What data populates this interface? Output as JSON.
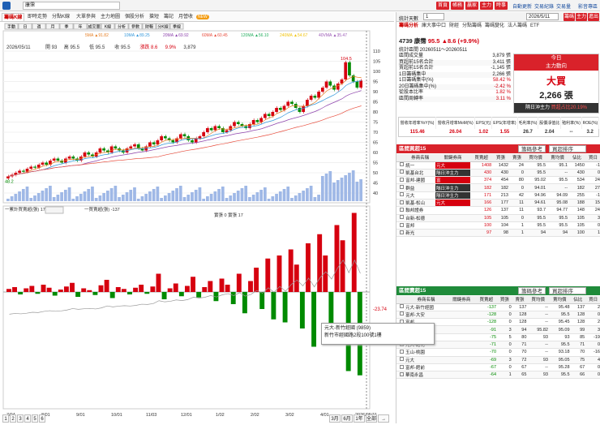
{
  "app": {
    "title": "康霈",
    "search": ""
  },
  "top_buttons": [
    "首頁",
    "帳務",
    "贏家",
    "主力",
    "時事"
  ],
  "top_links": [
    "自動更新",
    "交易紀錄",
    "交易量",
    "影音專區"
  ],
  "chart_tabs": [
    "籌碼K線",
    "即時走勢",
    "分點K線",
    "大單參與",
    "主力地圖",
    "個股分析",
    "搶短",
    "籌記",
    "月營收",
    "NEW"
  ],
  "chart_sub": [
    "手動",
    "日",
    "週",
    "月",
    "季",
    "年",
    "成交量",
    "K線",
    "分析",
    "參數",
    "財報",
    "分K線",
    "季線"
  ],
  "ma_legend": [
    "5MA ▲91.82",
    "10MA ▲89.25",
    "20MA ▲69.92",
    "60MA ▲60.45",
    "120MA ▲56.10",
    "240MA ▲54.67",
    "40VMA ▲35.47"
  ],
  "ohlc": {
    "date": "2026/05/11",
    "o": "開 93",
    "h": "高 95.5",
    "l": "低 95.5",
    "c": "收 95.5",
    "chg": "漲跌 8.6",
    "pct": "9.9%",
    "vol": "3,879"
  },
  "sub_legend": [
    "一累計買賣超(張) 17",
    "一買賣超(張) -137",
    "實張 0 實張 17"
  ],
  "peak_label": "104.5",
  "low_label": "48.2",
  "price_axis": [
    "110",
    "105",
    "100",
    "95",
    "90",
    "85",
    "80",
    "75",
    "70",
    "65",
    "60",
    "55",
    "50",
    "45",
    "40"
  ],
  "sub_axis": {
    "top": "",
    "mid": "",
    "last": "-23.74"
  },
  "date_axis": [
    "7/04",
    "8/01",
    "9/01",
    "10/01",
    "11/03",
    "12/01",
    "1/02",
    "2/02",
    "3/02",
    "4/01",
    "2026/05/11"
  ],
  "bottom_left": [
    "1",
    "2",
    "3",
    "4",
    "5",
    "6"
  ],
  "bottom_right": [
    "3月",
    "6月",
    "1年",
    "全部",
    "→"
  ],
  "right": {
    "days_label": "統計天數",
    "days_value": "1",
    "date_label": "2026/5/11",
    "btns": [
      "籌碼",
      "主力",
      "進出"
    ],
    "tabs": [
      "籌碼分析",
      "庫大事中口",
      "財經",
      "分點籌碼",
      "籌碼變化",
      "法人籌碼",
      "ETF"
    ],
    "stock": "4739 康霈",
    "price": "95.5",
    "change": "▲8.6 (+9.9%)",
    "info": [
      [
        "區間成交量",
        "3,879 張"
      ],
      [
        "買超前15名合計",
        "3,411 張"
      ],
      [
        "賣超前15名合計",
        "-1,145 張"
      ],
      [
        "1日籌碼集中",
        "2,266 張"
      ],
      [
        "1日籌碼集中(%)",
        "58.42 %"
      ],
      [
        "20日籌碼集中(%)",
        "-2.42 %"
      ],
      [
        "從股本比率",
        "1.82 %"
      ],
      [
        "區間周轉率",
        "3.11 %"
      ]
    ],
    "range": "統計區間 20260511～20260511",
    "today": "今日",
    "main_force": "主力動向",
    "big": "大買",
    "big_val": "2,266 張",
    "next": "隔日沖主力",
    "next_val": "買超占比20.19%",
    "metrics_h": [
      "營收年增率YoY(%)",
      "營收月增率MoM(%)",
      "EPS(元)",
      "EPS(年增率)",
      "毛利率(%)",
      "股價淨值比",
      "殖利率(%)",
      "ROE(%)"
    ],
    "metrics_v": [
      "115.46",
      "26.04",
      "1.02",
      "1.55",
      "26.7",
      "2.04",
      "--",
      "3.2"
    ],
    "buy_title": "區間買超15",
    "sell_title": "區間賣超15",
    "filter": "籌碼參考",
    "rank": "買超排序",
    "cols": [
      "券商名稱",
      "關鍵券商",
      "買賣超",
      "買張",
      "賣張",
      "買均價",
      "賣均價",
      "佔比",
      "買日"
    ],
    "buy_rows": [
      [
        "統一",
        "元大",
        "1408",
        "1432",
        "24",
        "95.5",
        "95.1",
        "1450",
        "-1"
      ],
      [
        "凱基台北",
        "隔日沖主力",
        "430",
        "430",
        "0",
        "95.5",
        "--",
        "430",
        "0"
      ],
      [
        "富邦-建國",
        "富",
        "374",
        "454",
        "80",
        "95.02",
        "95.5",
        "534",
        "24"
      ],
      [
        "群益",
        "隔日沖主力",
        "182",
        "182",
        "0",
        "94.01",
        "--",
        "182",
        "27"
      ],
      [
        "元大",
        "隔日沖主力",
        "171",
        "213",
        "42",
        "94.96",
        "94.09",
        "255",
        "-1"
      ],
      [
        "凱基-松山",
        "元大",
        "166",
        "177",
        "11",
        "94.61",
        "95.08",
        "188",
        "15"
      ],
      [
        "聯邦證券",
        "",
        "126",
        "137",
        "11",
        "93.7",
        "94.77",
        "148",
        "24"
      ],
      [
        "台新-松德",
        "",
        "105",
        "105",
        "0",
        "95.5",
        "95.5",
        "105",
        "3"
      ],
      [
        "富邦",
        "",
        "100",
        "104",
        "1",
        "95.5",
        "95.5",
        "105",
        "0"
      ],
      [
        "新光",
        "",
        "97",
        "98",
        "1",
        "94",
        "94",
        "100",
        "1"
      ]
    ],
    "sell_rows": [
      [
        "元大-新竹經國",
        "",
        "-137",
        "0",
        "137",
        "--",
        "95.48",
        "137",
        "2"
      ],
      [
        "富邦-大安",
        "",
        "-128",
        "0",
        "128",
        "--",
        "95.5",
        "128",
        "0"
      ],
      [
        "富邦",
        "",
        "-128",
        "0",
        "128",
        "--",
        "95.45",
        "128",
        "2"
      ],
      [
        "美商高盛",
        "",
        "-91",
        "3",
        "94",
        "95.82",
        "95.09",
        "99",
        "3"
      ],
      [
        "永豐金-松山",
        "",
        "-75",
        "5",
        "80",
        "93",
        "93",
        "85",
        "-19"
      ],
      [
        "元大-館化",
        "",
        "-71",
        "0",
        "71",
        "--",
        "95.5",
        "71",
        "0"
      ],
      [
        "玉山-桃園",
        "",
        "-70",
        "0",
        "70",
        "--",
        "93.18",
        "70",
        "-16"
      ],
      [
        "元大",
        "",
        "-69",
        "3",
        "72",
        "93",
        "95.05",
        "75",
        "4"
      ],
      [
        "富邦-館前",
        "",
        "-67",
        "0",
        "67",
        "--",
        "95.28",
        "67",
        "0"
      ],
      [
        "華南永昌",
        "",
        "-64",
        "1",
        "65",
        "93",
        "95.5",
        "66",
        "0"
      ]
    ],
    "tooltip": [
      "元大-新竹經國 (9859)",
      "新竹市經國路2段100號1樓"
    ]
  },
  "chart_data": {
    "type": "candlestick+bar",
    "price_range": [
      40,
      112
    ],
    "candles_close": [
      48.2,
      49,
      50,
      51,
      50.5,
      52,
      53,
      52.5,
      54,
      55,
      54,
      56,
      57,
      56,
      55,
      57,
      58,
      57,
      56,
      58,
      60,
      59,
      58,
      60,
      62,
      61,
      60,
      63,
      62,
      61,
      60,
      62,
      63,
      64,
      62,
      61,
      63,
      65,
      64,
      66,
      68,
      67,
      66,
      65,
      67,
      69,
      68,
      66,
      65,
      67,
      68,
      70,
      72,
      71,
      73,
      72,
      70,
      71,
      73,
      75,
      74,
      73,
      72,
      74,
      76,
      75,
      77,
      79,
      78,
      80,
      82,
      81,
      83,
      85,
      84,
      82,
      80,
      83,
      86,
      88,
      87,
      90,
      92,
      95,
      93,
      91,
      94,
      96,
      104.5,
      98,
      95,
      92,
      95.5
    ],
    "flow": [
      5,
      8,
      -4,
      6,
      10,
      -3,
      12,
      7,
      -6,
      4,
      9,
      15,
      -8,
      6,
      3,
      -5,
      11,
      20,
      -10,
      8,
      5,
      -4,
      7,
      12,
      -3,
      9,
      30,
      -12,
      6,
      14,
      -7,
      10,
      25,
      -9,
      8,
      18,
      -15,
      22,
      12,
      -20,
      30,
      -35,
      18,
      40,
      -28,
      55,
      -45,
      60,
      -50,
      70,
      45,
      -60,
      80,
      -90,
      95,
      60,
      -75,
      110,
      85,
      -130,
      130,
      -137
    ]
  }
}
